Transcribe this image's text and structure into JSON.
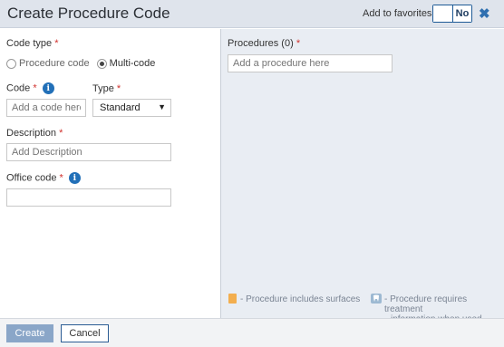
{
  "header": {
    "title": "Create Procedure Code",
    "favorites_label": "Add to favorites",
    "favorites_toggle": "No",
    "close_glyph": "✖"
  },
  "left": {
    "code_type_label": "Code type",
    "required_mark": "*",
    "code_type_options": [
      "Procedure code",
      "Multi-code"
    ],
    "code_type_selected": "Multi-code",
    "code_label": "Code",
    "code_placeholder": "Add a code here",
    "type_label": "Type",
    "type_value": "Standard",
    "description_label": "Description",
    "description_placeholder": "Add Description",
    "office_code_label": "Office code",
    "office_code_value": ""
  },
  "right": {
    "procedures_label": "Procedures (0)",
    "procedure_placeholder": "Add a procedure here",
    "legend_surfaces": "- Procedure includes surfaces",
    "legend_treatment_line1": "- Procedure requires treatment",
    "legend_treatment_line2": "information when used"
  },
  "footer": {
    "create_label": "Create",
    "cancel_label": "Cancel"
  },
  "icons": {
    "info": "info-icon",
    "surfaces": "orange-swatch-icon",
    "tooth": "tooth-icon",
    "close": "close-icon",
    "caret": "caret-down-icon"
  },
  "colors": {
    "header_bg": "#dfe4ec",
    "right_panel_bg": "#e9edf3",
    "info_blue": "#2270b8",
    "required_red": "#d0312d",
    "create_button": "#8aa6c8",
    "surface_swatch": "#f3ae4e"
  }
}
